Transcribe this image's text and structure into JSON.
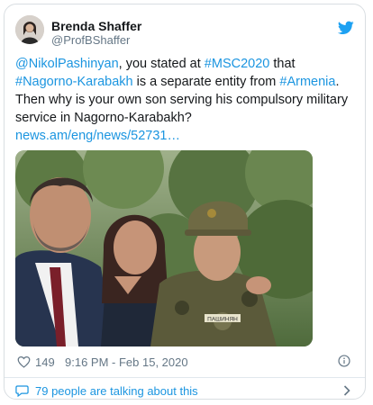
{
  "author": {
    "name": "Brenda Shaffer",
    "handle": "@ProfBShaffer",
    "avatar_icon": "profile-avatar",
    "platform_icon": "twitter-bird-icon"
  },
  "tweet": {
    "segments": [
      {
        "text": "@NikolPashinyan",
        "link": true
      },
      {
        "text": ", you stated at ",
        "link": false
      },
      {
        "text": "#MSC2020",
        "link": true
      },
      {
        "text": " that ",
        "link": false
      },
      {
        "text": "#Nagorno-Karabakh",
        "link": true
      },
      {
        "text": " is a separate entity from ",
        "link": false
      },
      {
        "text": "#Armenia",
        "link": true
      },
      {
        "text": ". Then why is your own son serving  his compulsory military service in  Nagorno-Karabakh?",
        "link": false
      },
      {
        "text": "news.am/eng/news/52731…",
        "link": true
      }
    ]
  },
  "photo": {
    "alt": "Photo of three people outdoors in front of trees",
    "name_tag": "ПАШИНЯН"
  },
  "stats": {
    "likes": "149",
    "timestamp": "9:16 PM - Feb 15, 2020"
  },
  "footer": {
    "talking": "79 people are talking about this"
  },
  "colors": {
    "link": "#1b95e0",
    "secondary": "#657786",
    "border": "#d9dee2"
  }
}
